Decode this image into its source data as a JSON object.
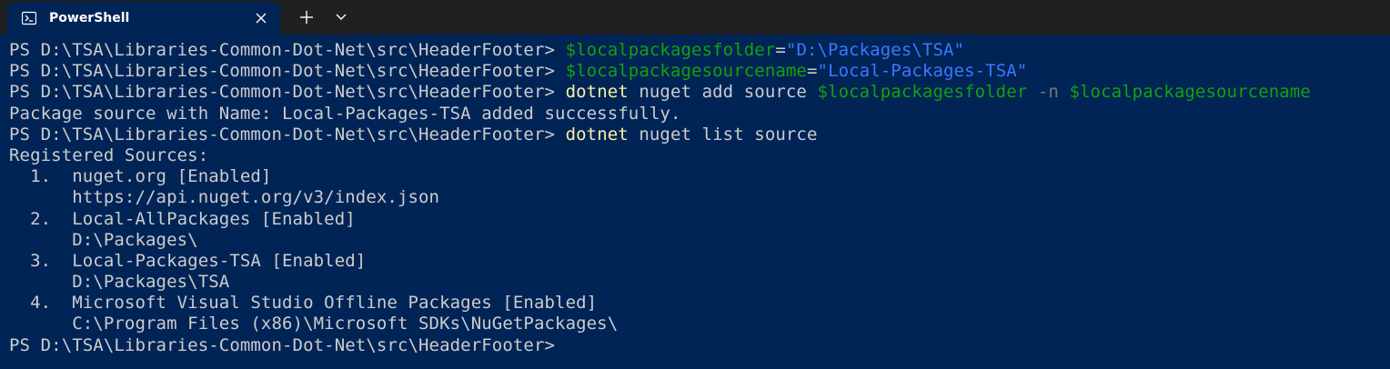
{
  "titlebar": {
    "tab_title": "PowerShell",
    "tab_icon": "powershell-icon",
    "close_icon": "close-icon",
    "new_tab_icon": "plus-icon",
    "dropdown_icon": "chevron-down-icon"
  },
  "colors": {
    "background": "#012456",
    "titlebar": "#202020",
    "text": "#cccccc",
    "command": "#f9f1a5",
    "variable": "#13a10e",
    "string": "#3b78ff",
    "parameter": "#767676"
  },
  "terminal": {
    "prompt": "PS D:\\TSA\\Libraries-Common-Dot-Net\\src\\HeaderFooter> ",
    "cmd1": {
      "var": "$localpackagesfolder",
      "op": "=",
      "str": "\"D:\\Packages\\TSA\""
    },
    "cmd2": {
      "var": "$localpackagesourcename",
      "op": "=",
      "str": "\"Local-Packages-TSA\""
    },
    "cmd3": {
      "cmd": "dotnet",
      "args": " nuget add source ",
      "var1": "$localpackagesfolder",
      "param": " -n ",
      "var2": "$localpackagesourcename"
    },
    "out1": "Package source with Name: Local-Packages-TSA added successfully.",
    "cmd4": {
      "cmd": "dotnet",
      "args": " nuget list source"
    },
    "out_lines": [
      "Registered Sources:",
      "  1.  nuget.org [Enabled]",
      "      https://api.nuget.org/v3/index.json",
      "  2.  Local-AllPackages [Enabled]",
      "      D:\\Packages\\",
      "  3.  Local-Packages-TSA [Enabled]",
      "      D:\\Packages\\TSA",
      "  4.  Microsoft Visual Studio Offline Packages [Enabled]",
      "      C:\\Program Files (x86)\\Microsoft SDKs\\NuGetPackages\\"
    ]
  }
}
